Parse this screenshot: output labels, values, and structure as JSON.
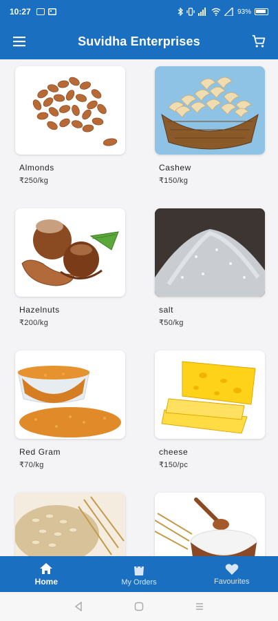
{
  "status_bar": {
    "time": "10:27",
    "battery_text": "93%"
  },
  "app_bar": {
    "title": "Suvidha Enterprises",
    "menu_icon": "hamburger-menu-icon",
    "cart_icon": "shopping-cart-icon"
  },
  "products": [
    {
      "name": "Almonds",
      "price": "₹250/kg",
      "image": "almonds"
    },
    {
      "name": "Cashew",
      "price": "₹150/kg",
      "image": "cashew-basket"
    },
    {
      "name": "Hazelnuts",
      "price": "₹200/kg",
      "image": "hazelnuts"
    },
    {
      "name": "salt",
      "price": "₹50/kg",
      "image": "salt-pile"
    },
    {
      "name": "Red Gram",
      "price": "₹70/kg",
      "image": "red-gram-bowl"
    },
    {
      "name": "cheese",
      "price": "₹150/pc",
      "image": "cheese-block"
    },
    {
      "name": "",
      "price": "",
      "image": "oats-wheat"
    },
    {
      "name": "",
      "price": "",
      "image": "flour-bowl"
    }
  ],
  "bottom_nav": {
    "items": [
      {
        "label": "Home",
        "icon": "home-icon",
        "active": true
      },
      {
        "label": "My Orders",
        "icon": "shopping-bag-icon",
        "active": false
      },
      {
        "label": "Favourites",
        "icon": "heart-icon",
        "active": false
      }
    ]
  },
  "system_nav": {
    "back": "back-triangle-icon",
    "home": "home-square-icon",
    "recents": "recents-lines-icon"
  }
}
